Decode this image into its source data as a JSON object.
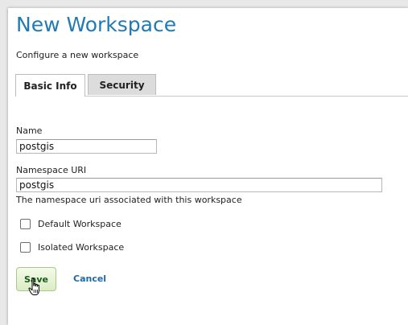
{
  "page": {
    "title": "New Workspace",
    "subtitle": "Configure a new workspace"
  },
  "tabs": [
    {
      "label": "Basic Info",
      "active": true
    },
    {
      "label": "Security",
      "active": false
    }
  ],
  "form": {
    "name": {
      "label": "Name",
      "value": "postgis"
    },
    "namespace_uri": {
      "label": "Namespace URI",
      "value": "postgis",
      "help": "The namespace uri associated with this workspace"
    },
    "default_workspace": {
      "label": "Default Workspace",
      "checked": false
    },
    "isolated_workspace": {
      "label": "Isolated Workspace",
      "checked": false
    }
  },
  "actions": {
    "save_label": "Save",
    "cancel_label": "Cancel"
  },
  "colors": {
    "title": "#1f7ab5",
    "save_button_bg": "#dbecc5",
    "cancel_link": "#1f6aa5"
  },
  "icons": {
    "cursor": "hand-pointer-icon"
  }
}
